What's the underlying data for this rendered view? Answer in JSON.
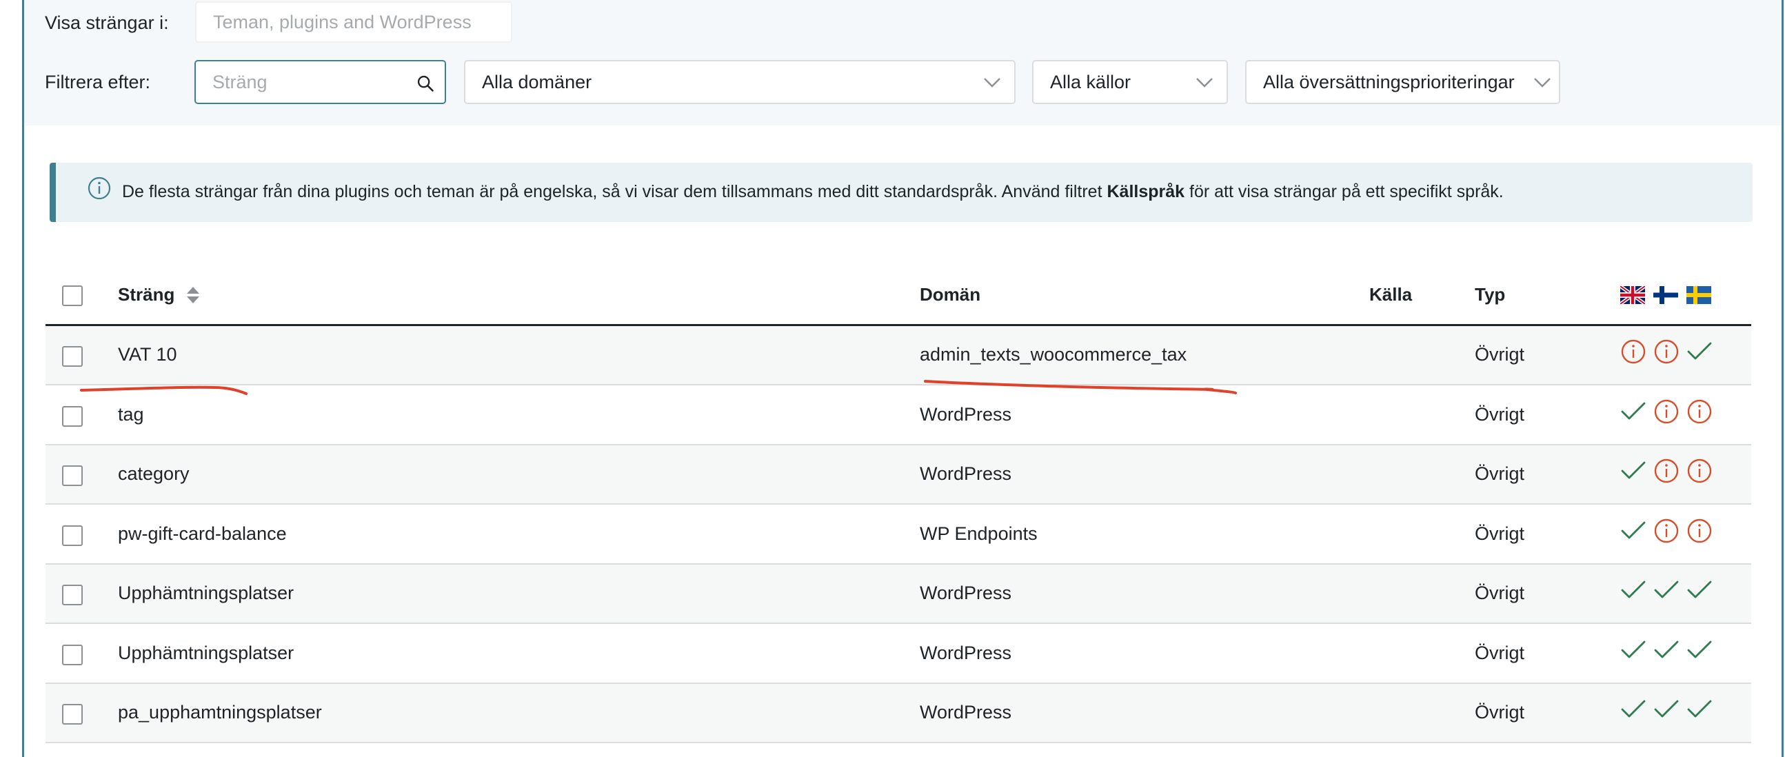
{
  "filters": {
    "show_strings_label": "Visa strängar i:",
    "show_strings_placeholder": "Teman, plugins and WordPress",
    "filter_label": "Filtrera efter:",
    "search_placeholder": "Sträng",
    "domain_select": "Alla domäner",
    "source_select": "Alla källor",
    "priority_select": "Alla översättningsprioriteringar"
  },
  "notice": {
    "text_before": "De flesta strängar från dina plugins och teman är på engelska, så vi visar dem tillsammans med ditt standardspråk. Använd filtret ",
    "text_bold": "Källspråk",
    "text_after": " för att visa strängar på ett specifikt språk."
  },
  "table": {
    "headers": {
      "string": "Sträng",
      "domain": "Domän",
      "source": "Källa",
      "type": "Typ"
    },
    "languages": [
      "English (UK flag)",
      "Finnish (flag)",
      "Swedish (flag)"
    ],
    "rows": [
      {
        "string": "VAT 10",
        "domain": "admin_texts_woocommerce_tax",
        "source": "",
        "type": "Övrigt",
        "status": [
          "info",
          "info",
          "check"
        ]
      },
      {
        "string": "tag",
        "domain": "WordPress",
        "source": "",
        "type": "Övrigt",
        "status": [
          "check",
          "info",
          "info"
        ]
      },
      {
        "string": "category",
        "domain": "WordPress",
        "source": "",
        "type": "Övrigt",
        "status": [
          "check",
          "info",
          "info"
        ]
      },
      {
        "string": "pw-gift-card-balance",
        "domain": "WP Endpoints",
        "source": "",
        "type": "Övrigt",
        "status": [
          "check",
          "info",
          "info"
        ]
      },
      {
        "string": "Upphämtningsplatser",
        "domain": "WordPress",
        "source": "",
        "type": "Övrigt",
        "status": [
          "check",
          "check",
          "check"
        ]
      },
      {
        "string": "Upphämtningsplatser",
        "domain": "WordPress",
        "source": "",
        "type": "Övrigt",
        "status": [
          "check",
          "check",
          "check"
        ]
      },
      {
        "string": "pa_upphamtningsplatser",
        "domain": "WordPress",
        "source": "",
        "type": "Övrigt",
        "status": [
          "check",
          "check",
          "check"
        ]
      }
    ]
  },
  "colors": {
    "info": "#d64e2a",
    "check": "#2e7d4f",
    "accent": "#3f7f92",
    "annotation": "#e0412a"
  },
  "icons": [
    "search-icon",
    "chevron-down-icon",
    "info-icon",
    "sort-icon",
    "check-icon",
    "flag-uk-icon",
    "flag-fi-icon",
    "flag-se-icon"
  ]
}
